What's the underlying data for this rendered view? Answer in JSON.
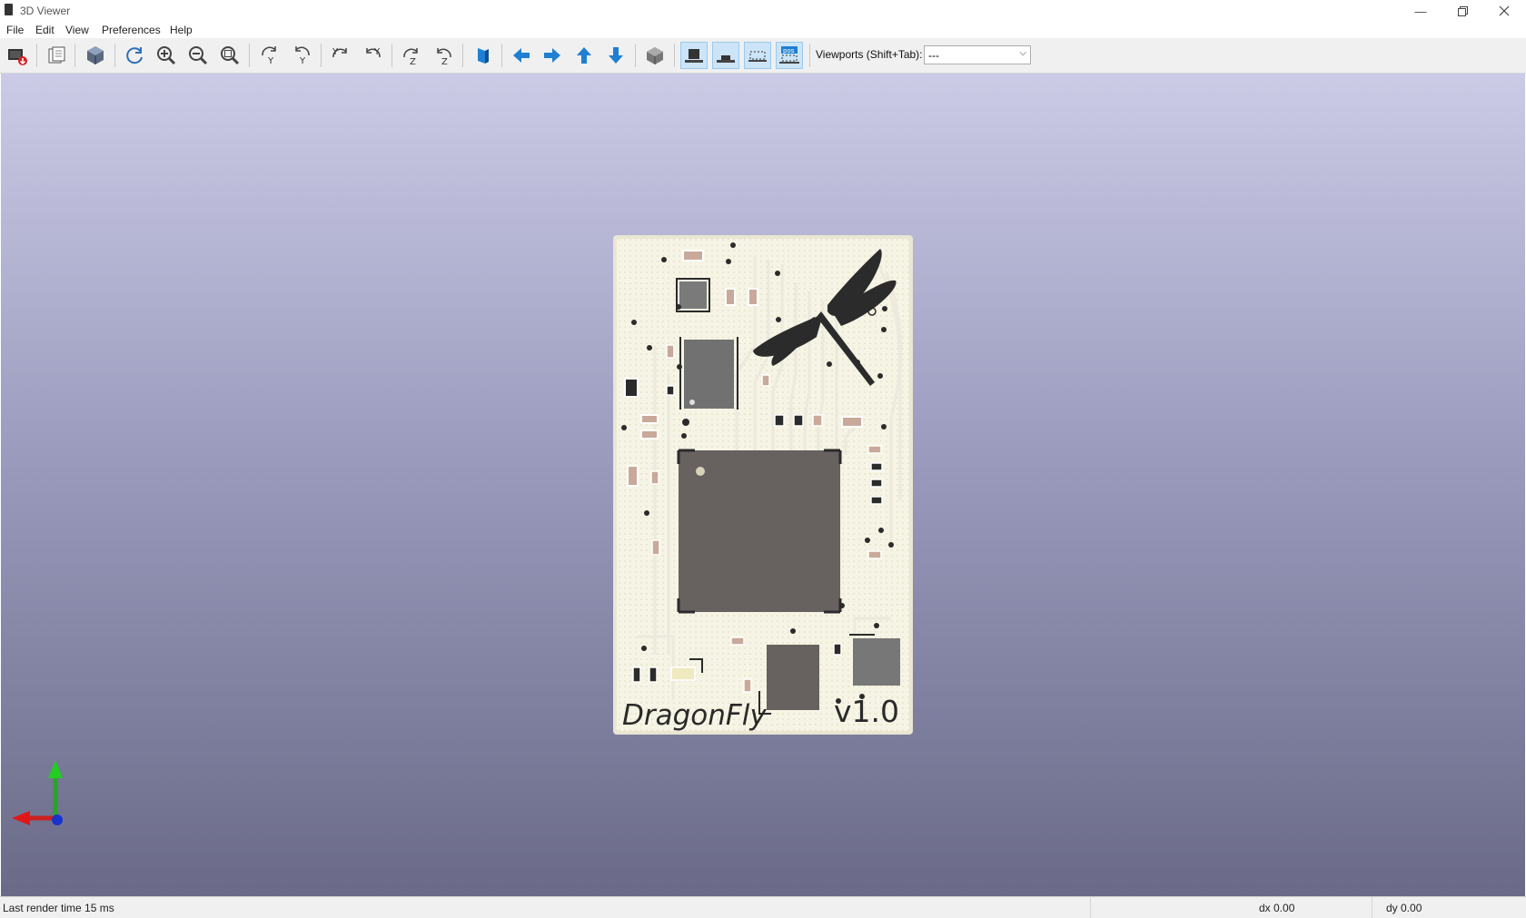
{
  "window": {
    "title": "3D Viewer",
    "controls": [
      "minimize-icon",
      "restore-icon",
      "close-icon"
    ]
  },
  "menubar": {
    "items": [
      "File",
      "Edit",
      "View",
      "Preferences",
      "Help"
    ]
  },
  "toolbar": {
    "buttons": [
      "render-icon",
      "copy-icon",
      "raytrace-icon",
      "reload-icon",
      "zoom-in-icon",
      "zoom-out-icon",
      "zoom-fit-icon",
      "rotate-x-cw-icon",
      "rotate-x-ccw-icon",
      "rotate-y-cw-icon",
      "rotate-y-ccw-icon",
      "rotate-z-cw-icon",
      "rotate-z-ccw-icon",
      "flip-board-icon",
      "pan-left-icon",
      "pan-right-icon",
      "pan-up-icon",
      "pan-down-icon",
      "ortho-icon",
      "show-tht-icon",
      "show-smd-icon",
      "show-virtual-icon",
      "show-not-in-posfile-icon"
    ],
    "active": [
      "show-tht-icon",
      "show-smd-icon",
      "show-virtual-icon",
      "show-not-in-posfile-icon"
    ],
    "viewports_label": "Viewports (Shift+Tab):",
    "viewports_value": "---"
  },
  "board": {
    "name_text": "DragonFly",
    "version_text": "v1.0",
    "colors": {
      "substrate": "#f6f4e4",
      "silkscreen": "#2a2a2a",
      "ic_body": "#67615f",
      "component_gray": "#6e6e6e",
      "passive": "#c9a99a"
    }
  },
  "statusbar": {
    "render_time": "Last render time 15 ms",
    "dx": "dx 0.00",
    "dy": "dy 0.00"
  },
  "colors": {
    "viewport_top": "#cbcbe6",
    "viewport_bottom": "#6a6a88",
    "toolbar_bg": "#f0f0f0",
    "accent_blue": "#1f7fd2"
  }
}
